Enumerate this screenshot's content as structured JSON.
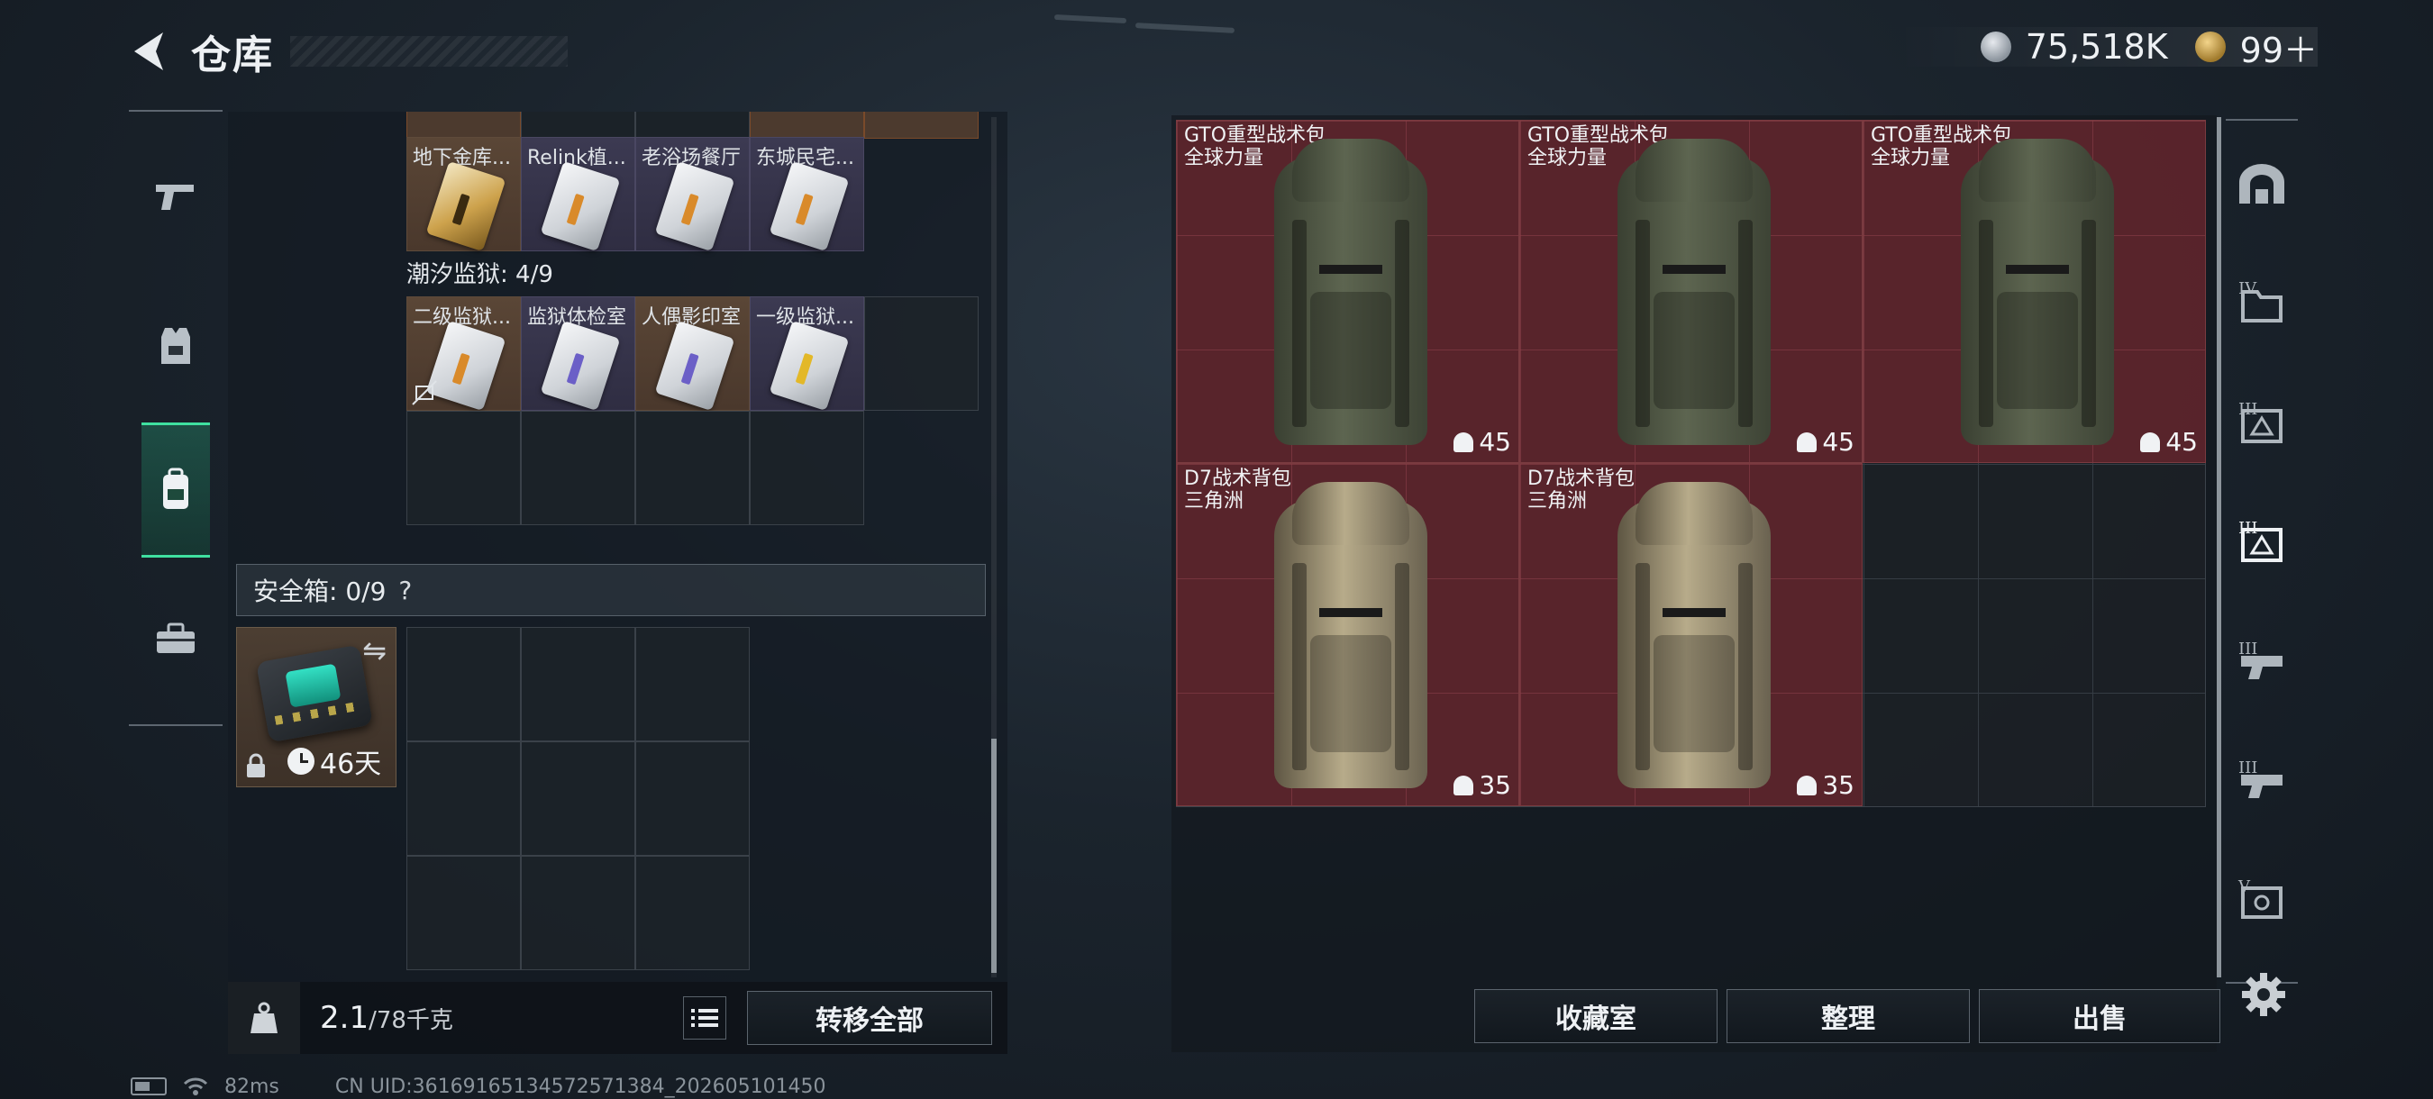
{
  "header": {
    "title": "仓库"
  },
  "currency": {
    "silver": "75,518K",
    "gold": "99＋"
  },
  "left_rail": {
    "items": [
      "weapon-tab",
      "armor-tab",
      "backpack-tab",
      "toolbox-tab"
    ]
  },
  "left_containers": {
    "row1_labels": [
      "地下金库...",
      "Relink植...",
      "老浴场餐厅",
      "东城民宅..."
    ],
    "section_title": "潮汐监狱: 4/9",
    "row2_labels": [
      "二级监狱...",
      "监狱体检室",
      "人偶影印室",
      "一级监狱..."
    ]
  },
  "safebox": {
    "title": "安全箱: 0/9",
    "help": "?",
    "timer": "46天"
  },
  "bottom_left": {
    "weight": "2.1",
    "capacity": "/78千克",
    "transfer_all": "转移全部"
  },
  "stash_items": [
    {
      "name": "GTO重型战术包",
      "sub": "全球力量",
      "durability": "45"
    },
    {
      "name": "GTO重型战术包",
      "sub": "全球力量",
      "durability": "45"
    },
    {
      "name": "GTO重型战术包",
      "sub": "全球力量",
      "durability": "45"
    },
    {
      "name": "D7战术背包",
      "sub": "三角洲",
      "durability": "35"
    },
    {
      "name": "D7战术背包",
      "sub": "三角洲",
      "durability": "35"
    }
  ],
  "right_rail": {
    "tiers": [
      "IV",
      "III",
      "III",
      "III",
      "III",
      "V"
    ]
  },
  "bottom_right": {
    "collection": "收藏室",
    "sort": "整理",
    "sell": "出售"
  },
  "status": {
    "ping": "82ms",
    "uid": "CN UID:3616916513457257138​4_202605101450"
  }
}
